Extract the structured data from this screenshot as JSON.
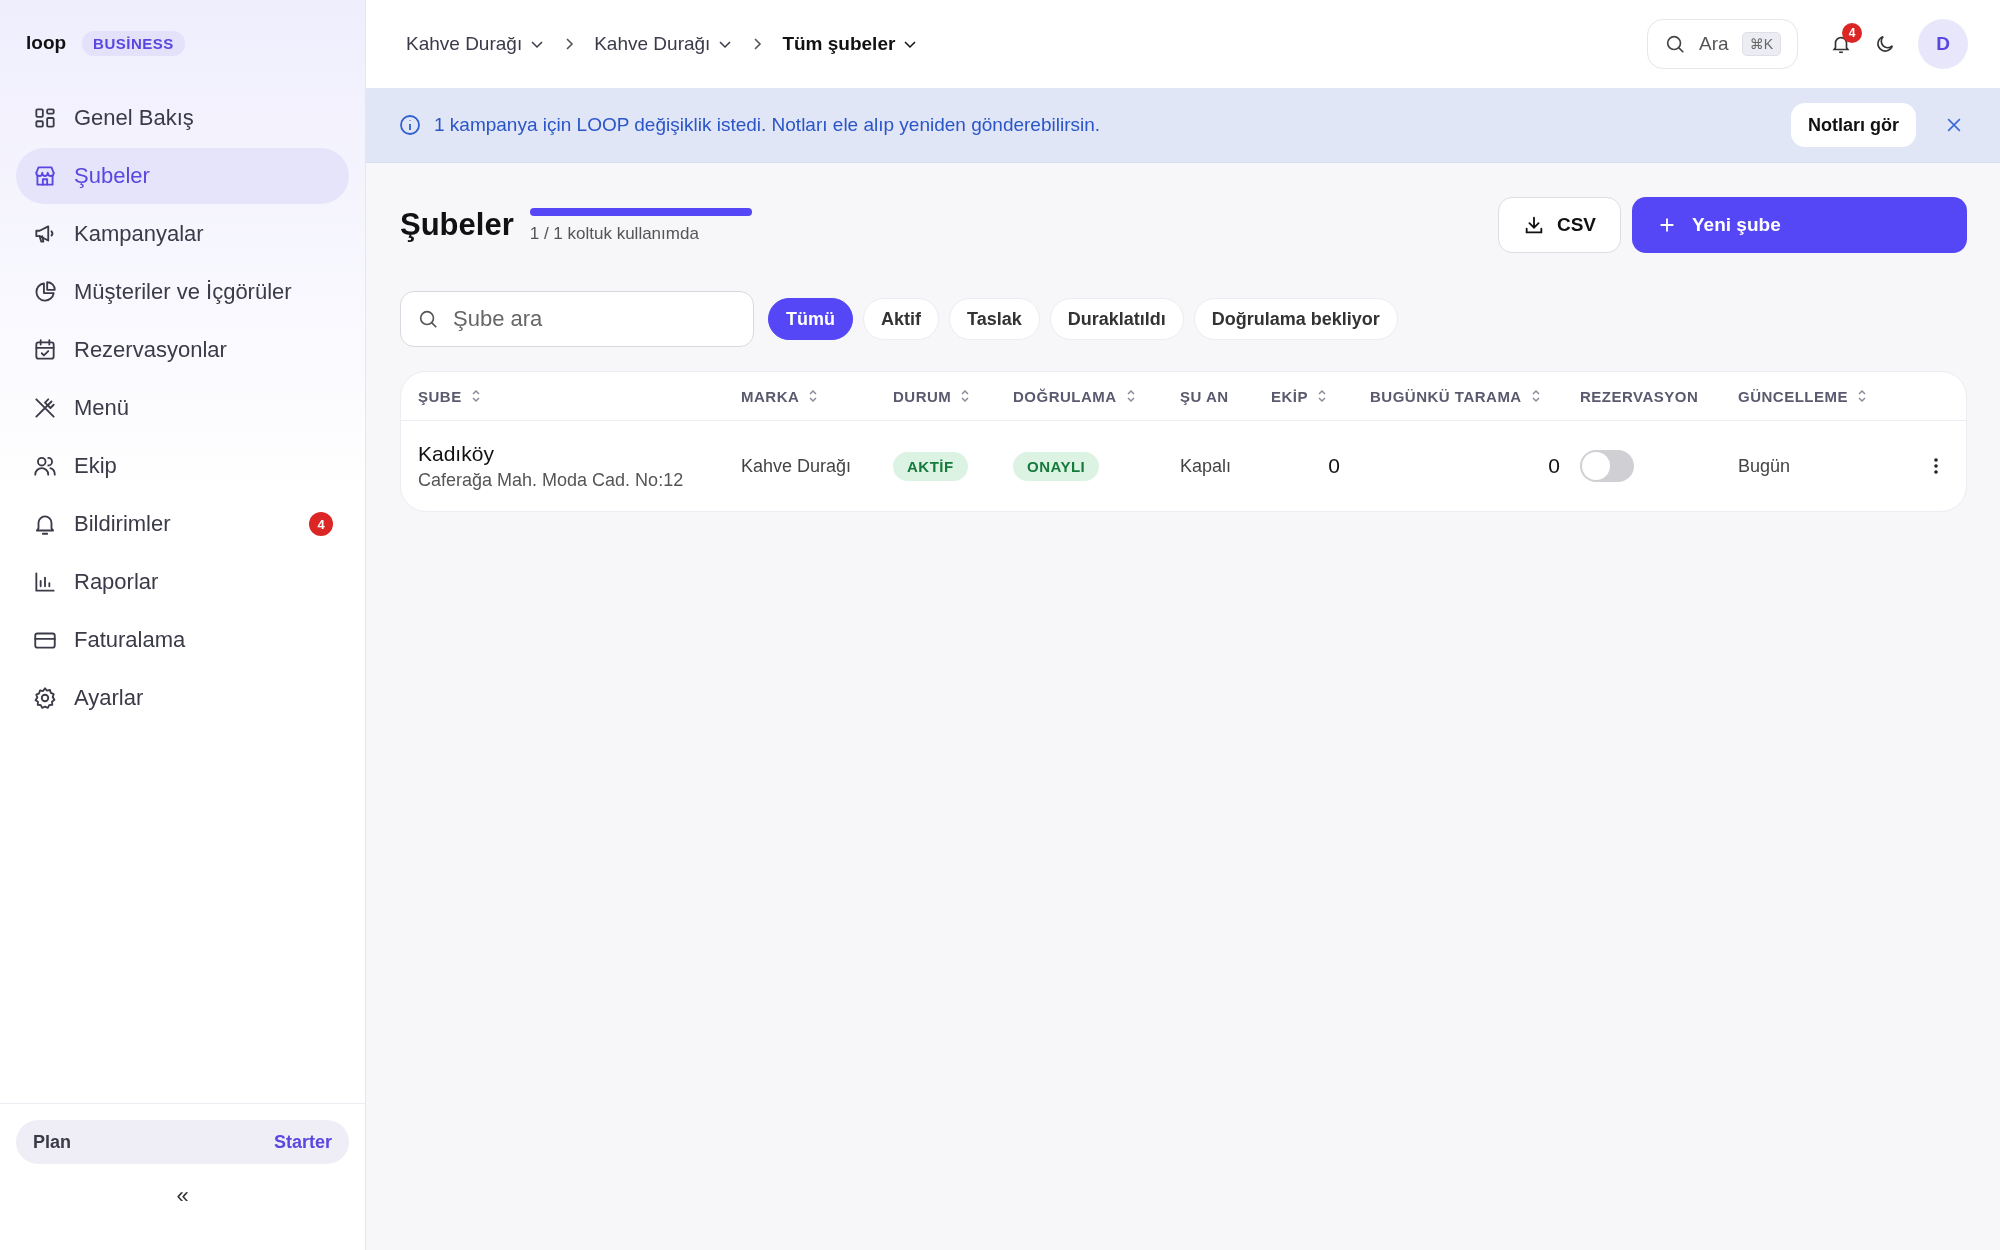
{
  "brand": {
    "logo": "loop",
    "badge": "BUSİNESS"
  },
  "sidebar": {
    "items": [
      {
        "label": "Genel Bakış",
        "selected": false
      },
      {
        "label": "Şubeler",
        "selected": true
      },
      {
        "label": "Kampanyalar",
        "selected": false
      },
      {
        "label": "Müşteriler ve İçgörüler",
        "selected": false
      },
      {
        "label": "Rezervasyonlar",
        "selected": false
      },
      {
        "label": "Menü",
        "selected": false
      },
      {
        "label": "Ekip",
        "selected": false
      },
      {
        "label": "Bildirimler",
        "selected": false,
        "badge": "4"
      },
      {
        "label": "Raporlar",
        "selected": false
      },
      {
        "label": "Faturalama",
        "selected": false
      },
      {
        "label": "Ayarlar",
        "selected": false
      }
    ],
    "plan": {
      "label": "Plan",
      "value": "Starter"
    },
    "collapse": "«"
  },
  "breadcrumbs": [
    {
      "label": "Kahve Durağı"
    },
    {
      "label": "Kahve Durağı"
    },
    {
      "label": "Tüm şubeler"
    }
  ],
  "topbar": {
    "search": {
      "placeholder": "Ara",
      "shortcut": "⌘K"
    },
    "notifications": "4",
    "avatar": "D"
  },
  "banner": {
    "text": "1 kampanya için LOOP değişiklik istedi. Notları ele alıp yeniden gönderebilirsin.",
    "action": "Notları gör"
  },
  "page": {
    "title": "Şubeler",
    "seats": {
      "level": 1,
      "text": "1 / 1 koltuk kullanımda"
    },
    "buttons": {
      "csv": "CSV",
      "new": "Yeni şube"
    }
  },
  "search": {
    "placeholder": "Şube ara"
  },
  "filters": [
    {
      "label": "Tümü",
      "selected": true
    },
    {
      "label": "Aktif",
      "selected": false
    },
    {
      "label": "Taslak",
      "selected": false
    },
    {
      "label": "Duraklatıldı",
      "selected": false
    },
    {
      "label": "Doğrulama bekliyor",
      "selected": false
    }
  ],
  "table": {
    "columns": [
      {
        "label": "ŞUBE",
        "sortable": true
      },
      {
        "label": "MARKA",
        "sortable": true
      },
      {
        "label": "DURUM",
        "sortable": true
      },
      {
        "label": "DOĞRULAMA",
        "sortable": true
      },
      {
        "label": "ŞU AN",
        "sortable": false
      },
      {
        "label": "EKİP",
        "sortable": true
      },
      {
        "label": "BUGÜNKÜ TARAMA",
        "sortable": true
      },
      {
        "label": "REZERVASYON",
        "sortable": false
      },
      {
        "label": "GÜNCELLEME",
        "sortable": true
      }
    ],
    "rows": [
      {
        "name": "Kadıköy",
        "address": "Caferağa Mah. Moda Cad. No:12",
        "brand": "Kahve Durağı",
        "status": "AKTİF",
        "verification": "ONAYLI",
        "now": "Kapalı",
        "team": "0",
        "scans": "0",
        "reservation": false,
        "updated": "Bugün"
      }
    ]
  }
}
